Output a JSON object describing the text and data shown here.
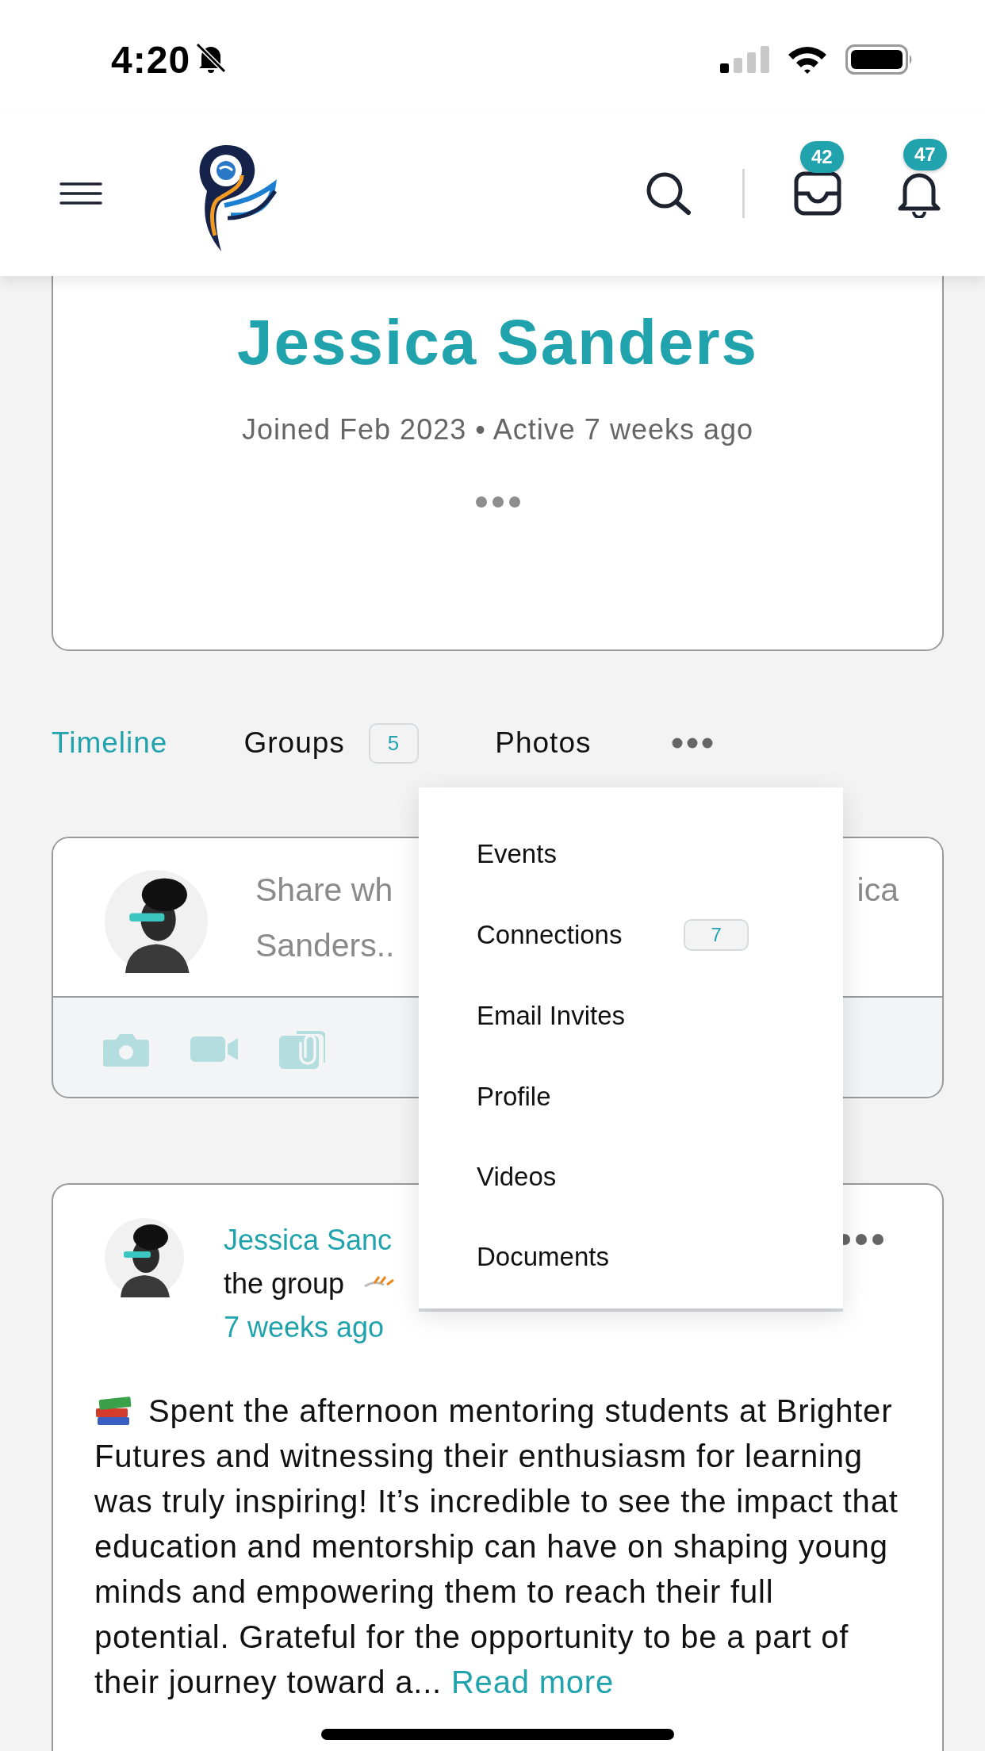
{
  "status_bar": {
    "time": "4:20",
    "silent": true
  },
  "header": {
    "inbox_count": "42",
    "notifications_count": "47"
  },
  "profile": {
    "name": "Jessica Sanders",
    "meta": "Joined Feb 2023 • Active 7 weeks ago"
  },
  "tabs": [
    {
      "label": "Timeline",
      "selected": true
    },
    {
      "label": "Groups",
      "count": "5",
      "selected": false
    },
    {
      "label": "Photos",
      "selected": false
    }
  ],
  "more_menu": {
    "open": true,
    "items": [
      {
        "label": "Events"
      },
      {
        "label": "Connections",
        "count": "7"
      },
      {
        "label": "Email Invites"
      },
      {
        "label": "Profile"
      },
      {
        "label": "Videos"
      },
      {
        "label": "Documents"
      }
    ]
  },
  "composer": {
    "placeholder_visible": [
      "Share wh",
      "ica",
      "Sanders.."
    ]
  },
  "post": {
    "author": "Jessica Sanc",
    "action": "the group",
    "time": "7 weeks ago",
    "text": "Spent the afternoon mentoring students at Brighter Futures and witnessing their enthusiasm for learning was truly inspiring! It’s incredible to see the impact that education and mentorship can have on shaping young minds and empowering them to reach their full potential. Grateful for the opportunity to be a part of their journey toward a...",
    "read_more": "Read more"
  }
}
